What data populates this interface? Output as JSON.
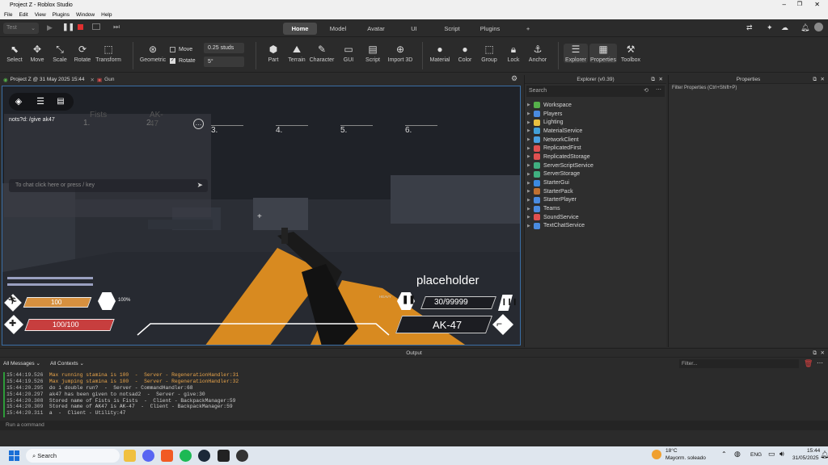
{
  "window": {
    "title": "Project Z - Roblox Studio"
  },
  "menu": [
    "File",
    "Edit",
    "View",
    "Plugins",
    "Window",
    "Help"
  ],
  "top_tabs": [
    "Home",
    "Model",
    "Avatar",
    "UI",
    "Script",
    "Plugins",
    "+"
  ],
  "mode_select": "Test",
  "ribbon": {
    "tools": [
      "Select",
      "Move",
      "Scale",
      "Rotate",
      "Transform"
    ],
    "geometric": "Geometric",
    "move_label": "Move",
    "rotate_label": "Rotate",
    "studs": "0.25 studs",
    "degrees": "5°",
    "insert": [
      "Part",
      "Terrain",
      "Character",
      "GUI",
      "Script",
      "Import 3D"
    ],
    "edit": [
      "Material",
      "Color",
      "Group",
      "Lock",
      "Anchor"
    ],
    "panels": [
      "Explorer",
      "Properties",
      "Toolbox"
    ]
  },
  "doc_tabs": [
    "Project Z @ 31 May 2025 15:44",
    "Gun"
  ],
  "game": {
    "chat_line": "nots?d: /give ak47",
    "chat_placeholder": "To chat click here or press / key",
    "slots": [
      {
        "n": "1.",
        "name": "Fists"
      },
      {
        "n": "2.",
        "name": "AK-47"
      },
      {
        "n": "3.",
        "name": ""
      },
      {
        "n": "4.",
        "name": ""
      },
      {
        "n": "5.",
        "name": ""
      },
      {
        "n": "6.",
        "name": ""
      }
    ],
    "stamina": "100",
    "health": "100/100",
    "armor_pct": "100%",
    "weapon_title": "placeholder",
    "ammo": "30/99999",
    "weapon_name": "AK-47",
    "fire_mode": "HEAVY",
    "stamina_fraction": 1.0,
    "health_fraction": 1.0
  },
  "explorer": {
    "title": "Explorer (v0.39)",
    "search_placeholder": "Search",
    "items": [
      {
        "name": "Workspace",
        "color": "#56b14a"
      },
      {
        "name": "Players",
        "color": "#4a8be0"
      },
      {
        "name": "Lighting",
        "color": "#e8c040"
      },
      {
        "name": "MaterialService",
        "color": "#42a0d8"
      },
      {
        "name": "NetworkClient",
        "color": "#4aa0e0"
      },
      {
        "name": "ReplicatedFirst",
        "color": "#e05050"
      },
      {
        "name": "ReplicatedStorage",
        "color": "#e05050"
      },
      {
        "name": "ServerScriptService",
        "color": "#40b080"
      },
      {
        "name": "ServerStorage",
        "color": "#40b080"
      },
      {
        "name": "StarterGui",
        "color": "#3c8ae0"
      },
      {
        "name": "StarterPack",
        "color": "#c07030"
      },
      {
        "name": "StarterPlayer",
        "color": "#4a8be0"
      },
      {
        "name": "Teams",
        "color": "#4a8be0"
      },
      {
        "name": "SoundService",
        "color": "#e05050"
      },
      {
        "name": "TextChatService",
        "color": "#4a8be0"
      }
    ]
  },
  "properties": {
    "title": "Properties",
    "filter_placeholder": "Filter Properties (Ctrl+Shift+P)"
  },
  "output": {
    "title": "Output",
    "messages_filter": "All Messages",
    "contexts_filter": "All Contexts",
    "filter_placeholder": "Filter...",
    "lines": [
      {
        "ts": "15:44:19.526",
        "msg": "Max running stamina is 100  -  Server - RegenerationHandler:31",
        "warn": true
      },
      {
        "ts": "15:44:19.526",
        "msg": "Max jumping stamina is 100  -  Server - RegenerationHandler:32",
        "warn": true
      },
      {
        "ts": "15:44:20.295",
        "msg": "do i double run?  -  Server - CommandHandler:68",
        "warn": false
      },
      {
        "ts": "15:44:20.297",
        "msg": "ak47 has been given to notsad2  -  Server - give:30",
        "warn": false
      },
      {
        "ts": "15:44:20.308",
        "msg": "Stored name of Fists is Fists  -  Client - BackpackManager:59",
        "warn": false
      },
      {
        "ts": "15:44:20.309",
        "msg": "Stored name of AK47 is AK-47  -  Client - BackpackManager:59",
        "warn": false
      },
      {
        "ts": "15:44:20.311",
        "msg": "a  -  Client - Utility:47",
        "warn": false
      }
    ],
    "command_placeholder": "Run a command"
  },
  "taskbar": {
    "search": "Search",
    "weather_temp": "18°C",
    "weather_desc": "Mayorm. soleado",
    "lang": "ENG",
    "time": "15:44",
    "date": "31/05/2025"
  }
}
